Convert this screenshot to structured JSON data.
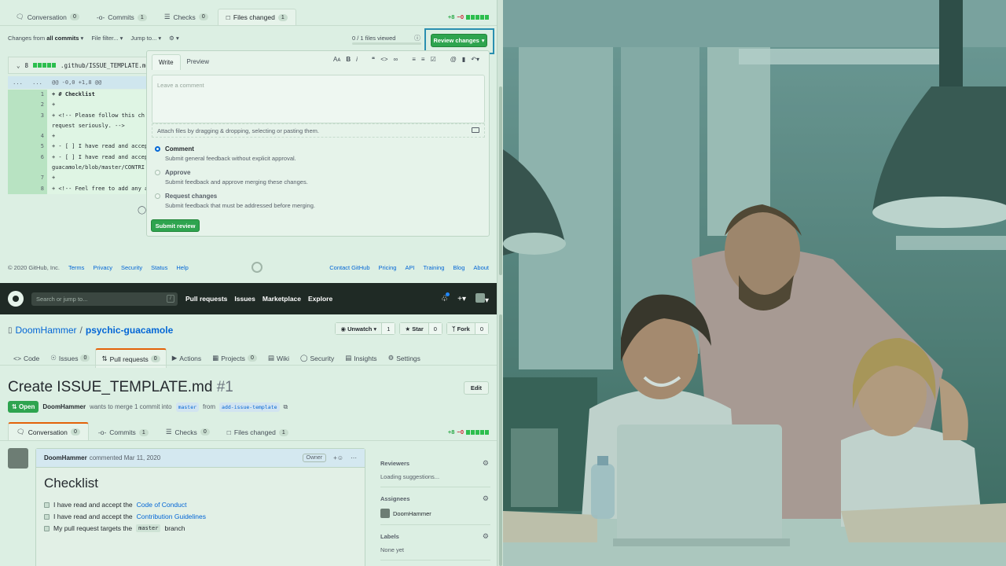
{
  "top": {
    "tabs": [
      {
        "label": "Conversation",
        "count": "0"
      },
      {
        "label": "Commits",
        "count": "1"
      },
      {
        "label": "Checks",
        "count": "0"
      },
      {
        "label": "Files changed",
        "count": "1"
      }
    ],
    "diffstat": {
      "add": "+8",
      "del": "−0"
    },
    "toolbar": {
      "changes_prefix": "Changes from",
      "changes_value": "all commits",
      "file_filter": "File filter...",
      "jump_to": "Jump to..."
    },
    "files_viewed": "0 / 1 files viewed",
    "review_button": "Review changes",
    "file": {
      "count": "8",
      "path": ".github/ISSUE_TEMPLATE.md"
    },
    "hunk": {
      "left": "...",
      "right": "...",
      "text": "@@ -0,0 +1,8 @@"
    },
    "code_lines": [
      {
        "n": "1",
        "text": "+ # Checklist",
        "bold": true
      },
      {
        "n": "2",
        "text": "+"
      },
      {
        "n": "3",
        "text": "+ <!-- Please follow this ch"
      },
      {
        "n": "",
        "text": "  request seriously. -->"
      },
      {
        "n": "4",
        "text": "+"
      },
      {
        "n": "5",
        "text": "+ - [ ] I have read and accep"
      },
      {
        "n": "6",
        "text": "+ - [ ] I have read and accep"
      },
      {
        "n": "",
        "text": "  guacamole/blob/master/CONTRI"
      },
      {
        "n": "7",
        "text": "+"
      },
      {
        "n": "8",
        "text": "+ <!-- Feel free to add any a"
      }
    ],
    "review": {
      "tab_write": "Write",
      "tab_preview": "Preview",
      "placeholder": "Leave a comment",
      "attach": "Attach files by dragging & dropping, selecting or pasting them.",
      "options": [
        {
          "title": "Comment",
          "desc": "Submit general feedback without explicit approval.",
          "selected": true
        },
        {
          "title": "Approve",
          "desc": "Submit feedback and approve merging these changes.",
          "selected": false
        },
        {
          "title": "Request changes",
          "desc": "Submit feedback that must be addressed before merging.",
          "selected": false
        }
      ],
      "submit": "Submit review"
    },
    "footer": {
      "copyright": "© 2020 GitHub, Inc.",
      "left_links": [
        "Terms",
        "Privacy",
        "Security",
        "Status",
        "Help"
      ],
      "right_links": [
        "Contact GitHub",
        "Pricing",
        "API",
        "Training",
        "Blog",
        "About"
      ]
    }
  },
  "bottom": {
    "header": {
      "search_placeholder": "Search or jump to...",
      "slash": "/",
      "nav": [
        "Pull requests",
        "Issues",
        "Marketplace",
        "Explore"
      ]
    },
    "repo": {
      "owner": "DoomHammer",
      "sep": "/",
      "name": "psychic-guacamole",
      "unwatch": "Unwatch",
      "unwatch_count": "1",
      "star": "Star",
      "star_count": "0",
      "fork": "Fork",
      "fork_count": "0"
    },
    "repo_tabs": [
      {
        "label": "Code",
        "count": ""
      },
      {
        "label": "Issues",
        "count": "0"
      },
      {
        "label": "Pull requests",
        "count": "0"
      },
      {
        "label": "Actions",
        "count": ""
      },
      {
        "label": "Projects",
        "count": "0"
      },
      {
        "label": "Wiki",
        "count": ""
      },
      {
        "label": "Security",
        "count": ""
      },
      {
        "label": "Insights",
        "count": ""
      },
      {
        "label": "Settings",
        "count": ""
      }
    ],
    "pr": {
      "title": "Create ISSUE_TEMPLATE.md",
      "number": "#1",
      "edit": "Edit",
      "state": "Open",
      "author": "DoomHammer",
      "meta_mid": "wants to merge 1 commit into",
      "base": "master",
      "from": "from",
      "head": "add-issue-template"
    },
    "tabs": [
      {
        "label": "Conversation",
        "count": "0"
      },
      {
        "label": "Commits",
        "count": "1"
      },
      {
        "label": "Checks",
        "count": "0"
      },
      {
        "label": "Files changed",
        "count": "1"
      }
    ],
    "diffstat": {
      "add": "+8",
      "del": "−0"
    },
    "comment": {
      "author": "DoomHammer",
      "action": "commented Mar 11, 2020",
      "role": "Owner",
      "heading": "Checklist",
      "items": [
        {
          "pre": "I have read and accept the",
          "link": "Code of Conduct"
        },
        {
          "pre": "I have read and accept the",
          "link": "Contribution Guidelines"
        }
      ],
      "item3_pre": "My pull request targets the",
      "item3_code": "master",
      "item3_post": "branch"
    },
    "sidebar": {
      "reviewers_title": "Reviewers",
      "reviewers_value": "Loading suggestions...",
      "assignees_title": "Assignees",
      "assignee": "DoomHammer",
      "labels_title": "Labels",
      "labels_value": "None yet"
    }
  },
  "colors": {
    "accent": "#2ea44f",
    "highlight": "#2a8fb0",
    "overlay": "#2d5b4f"
  }
}
